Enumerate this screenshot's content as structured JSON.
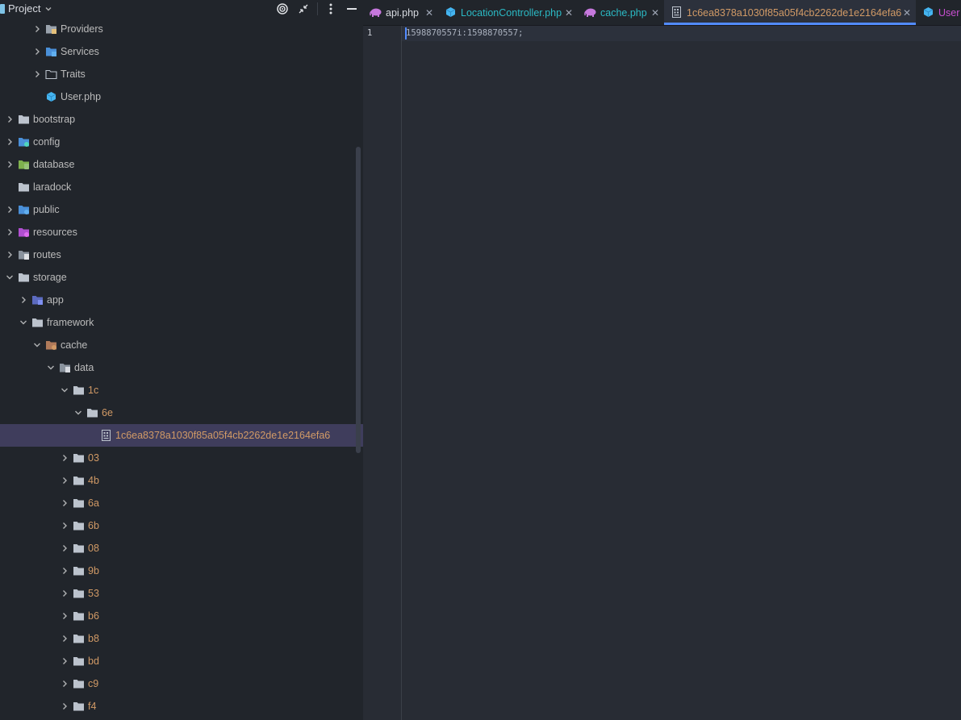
{
  "panel": {
    "title": "Project",
    "icons": [
      "target-icon",
      "collapse-icon",
      "more-icon",
      "minimize-icon"
    ]
  },
  "tree": [
    {
      "label": "Providers",
      "icon": "folder-providers",
      "level": 2,
      "expanded": false,
      "color": "default"
    },
    {
      "label": "Services",
      "icon": "folder-services",
      "level": 2,
      "expanded": false,
      "color": "default"
    },
    {
      "label": "Traits",
      "icon": "folder-outline",
      "level": 2,
      "expanded": false,
      "color": "default"
    },
    {
      "label": "User.php",
      "icon": "php-class",
      "level": 2,
      "leaf": true,
      "color": "default"
    },
    {
      "label": "bootstrap",
      "icon": "folder",
      "level": 0,
      "expanded": false,
      "color": "default"
    },
    {
      "label": "config",
      "icon": "folder-config",
      "level": 0,
      "expanded": false,
      "color": "default"
    },
    {
      "label": "database",
      "icon": "folder-database",
      "level": 0,
      "expanded": false,
      "color": "default"
    },
    {
      "label": "laradock",
      "icon": "folder",
      "level": 0,
      "leaf": true,
      "color": "default"
    },
    {
      "label": "public",
      "icon": "folder-public",
      "level": 0,
      "expanded": false,
      "color": "default"
    },
    {
      "label": "resources",
      "icon": "folder-resources",
      "level": 0,
      "expanded": false,
      "color": "default"
    },
    {
      "label": "routes",
      "icon": "folder-routes",
      "level": 0,
      "expanded": false,
      "color": "default"
    },
    {
      "label": "storage",
      "icon": "folder",
      "level": 0,
      "expanded": true,
      "color": "default"
    },
    {
      "label": "app",
      "icon": "folder-app",
      "level": 1,
      "expanded": false,
      "color": "default"
    },
    {
      "label": "framework",
      "icon": "folder",
      "level": 1,
      "expanded": true,
      "color": "default"
    },
    {
      "label": "cache",
      "icon": "folder-cache",
      "level": 2,
      "expanded": true,
      "color": "default"
    },
    {
      "label": "data",
      "icon": "folder-data",
      "level": 3,
      "expanded": true,
      "color": "default"
    },
    {
      "label": "1c",
      "icon": "folder",
      "level": 4,
      "expanded": true,
      "color": "orange"
    },
    {
      "label": "6e",
      "icon": "folder",
      "level": 5,
      "expanded": true,
      "color": "orange"
    },
    {
      "label": "1c6ea8378a1030f85a05f4cb2262de1e2164efa6",
      "icon": "file-text",
      "level": 6,
      "leaf": true,
      "color": "orange",
      "selected": true
    },
    {
      "label": "03",
      "icon": "folder",
      "level": 4,
      "expanded": false,
      "color": "orange"
    },
    {
      "label": "4b",
      "icon": "folder",
      "level": 4,
      "expanded": false,
      "color": "orange"
    },
    {
      "label": "6a",
      "icon": "folder",
      "level": 4,
      "expanded": false,
      "color": "orange"
    },
    {
      "label": "6b",
      "icon": "folder",
      "level": 4,
      "expanded": false,
      "color": "orange"
    },
    {
      "label": "08",
      "icon": "folder",
      "level": 4,
      "expanded": false,
      "color": "orange"
    },
    {
      "label": "9b",
      "icon": "folder",
      "level": 4,
      "expanded": false,
      "color": "orange"
    },
    {
      "label": "53",
      "icon": "folder",
      "level": 4,
      "expanded": false,
      "color": "orange"
    },
    {
      "label": "b6",
      "icon": "folder",
      "level": 4,
      "expanded": false,
      "color": "orange"
    },
    {
      "label": "b8",
      "icon": "folder",
      "level": 4,
      "expanded": false,
      "color": "orange"
    },
    {
      "label": "bd",
      "icon": "folder",
      "level": 4,
      "expanded": false,
      "color": "orange"
    },
    {
      "label": "c9",
      "icon": "folder",
      "level": 4,
      "expanded": false,
      "color": "orange"
    },
    {
      "label": "f4",
      "icon": "folder",
      "level": 4,
      "expanded": false,
      "color": "orange"
    }
  ],
  "tabs": [
    {
      "label": "api.php",
      "icon": "php-elephant-icon",
      "color": "#d7dae0",
      "close": "✕",
      "active": false
    },
    {
      "label": "LocationController.php",
      "icon": "php-class-icon",
      "color": "#2bbac5",
      "close": "✕",
      "active": false
    },
    {
      "label": "cache.php",
      "icon": "php-elephant-icon",
      "color": "#2bbac5",
      "close": "✕",
      "active": false
    },
    {
      "label": "1c6ea8378a1030f85a05f4cb2262de1e2164efa6",
      "icon": "text-file-icon",
      "color": "#d19a66",
      "close": "✕",
      "active": true
    },
    {
      "label": "User",
      "icon": "php-class-icon",
      "color": "#c94fd1",
      "close": "",
      "active": false
    }
  ],
  "editor": {
    "line_number": "1",
    "code": "1598870557i:1598870557;"
  },
  "colors": {
    "orange": "#d19a66",
    "default_text": "#bbbbbb",
    "selection": "#3f3d5c",
    "accent": "#528bff"
  }
}
